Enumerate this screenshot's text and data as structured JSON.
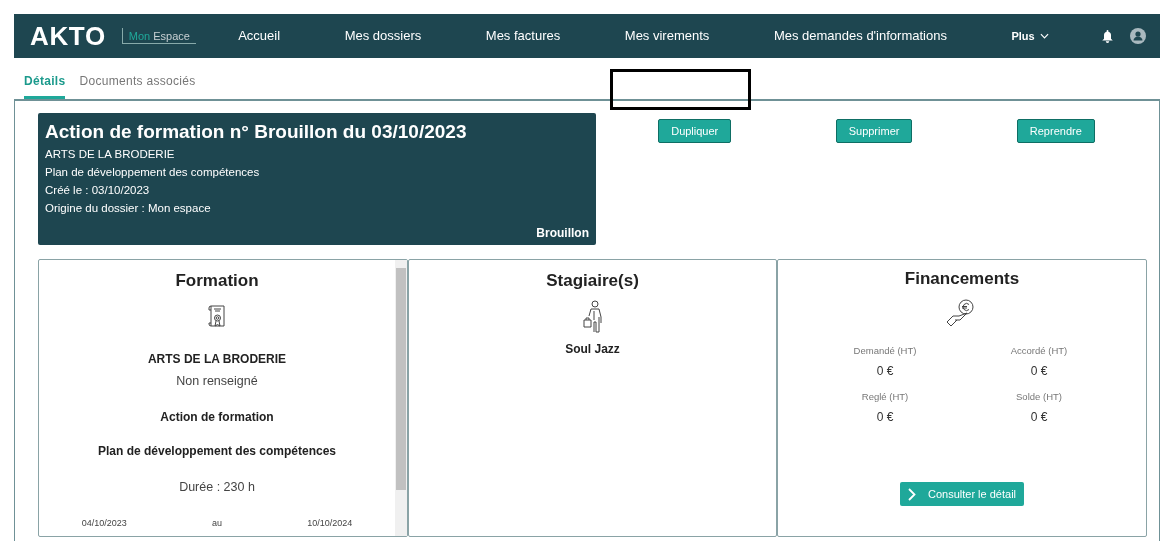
{
  "nav": {
    "logo": "AKTO",
    "space": [
      "Mon",
      "Espace"
    ],
    "items": [
      {
        "label": "Accueil",
        "kind": "link"
      },
      {
        "label": "Mes dossiers",
        "kind": "link"
      },
      {
        "label": "Mes factures",
        "kind": "link"
      },
      {
        "label": "Mes virements",
        "kind": "link"
      },
      {
        "label": "Mes demandes d'informations",
        "kind": "link"
      },
      {
        "label": "Plus",
        "kind": "menu"
      }
    ]
  },
  "tabs": [
    {
      "label": "Détails",
      "selected": true
    },
    {
      "label": "Documents associés",
      "selected": false
    }
  ],
  "header": {
    "title": "Action de formation n° Brouillon du 03/10/2023",
    "lines": [
      "ARTS DE LA BRODERIE",
      "Plan de développement des compétences",
      "Créé le : 03/10/2023",
      "Origine du dossier : Mon espace"
    ],
    "status": "Brouillon"
  },
  "actions": [
    "Dupliquer",
    "Supprimer",
    "Reprendre"
  ],
  "formation": {
    "title": "Formation",
    "organisme": "ARTS DE LA BRODERIE",
    "lieu": "Non renseigné",
    "type": "Action de formation",
    "dispositif": "Plan de développement des compétences",
    "duree": "Durée : 230 h",
    "start": "04/10/2023",
    "between": "au",
    "end": "10/10/2024"
  },
  "stagiaires": {
    "title": "Stagiaire(s)",
    "names": [
      "Soul Jazz"
    ]
  },
  "financements": {
    "title": "Financements",
    "amounts": [
      {
        "label": "Demandé (HT)",
        "value": "0 €"
      },
      {
        "label": "Accordé (HT)",
        "value": "0 €"
      },
      {
        "label": "Reglé (HT)",
        "value": "0 €"
      },
      {
        "label": "Solde (HT)",
        "value": "0 €"
      }
    ],
    "button": "Consulter le détail"
  }
}
